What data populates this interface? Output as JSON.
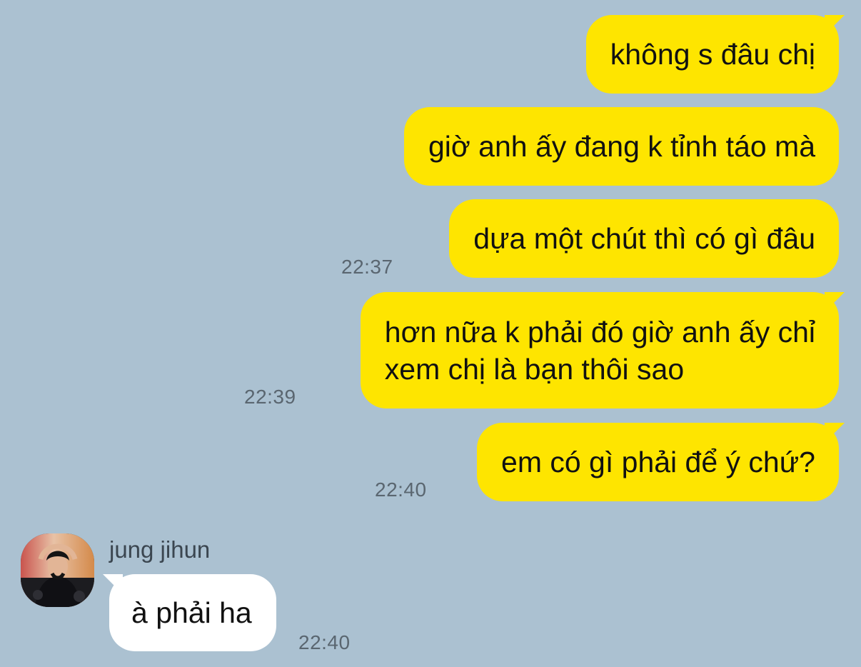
{
  "messages": [
    {
      "text": "không s đâu chị",
      "time": ""
    },
    {
      "text": "giờ anh ấy đang k tỉnh táo mà",
      "time": ""
    },
    {
      "text": "dựa một chút thì có gì đâu",
      "time": "22:37"
    },
    {
      "text_line1": "hơn nữa k phải đó giờ anh ấy chỉ",
      "text_line2": "xem chị là bạn thôi sao",
      "time": "22:39"
    },
    {
      "text": "em có gì phải để ý chứ?",
      "time": "22:40"
    }
  ],
  "incoming": {
    "sender": "jung jihun",
    "text": "à phải ha",
    "time": "22:40"
  },
  "colors": {
    "background": "#abc1d1",
    "outgoing_bubble": "#fee500",
    "incoming_bubble": "#ffffff"
  }
}
